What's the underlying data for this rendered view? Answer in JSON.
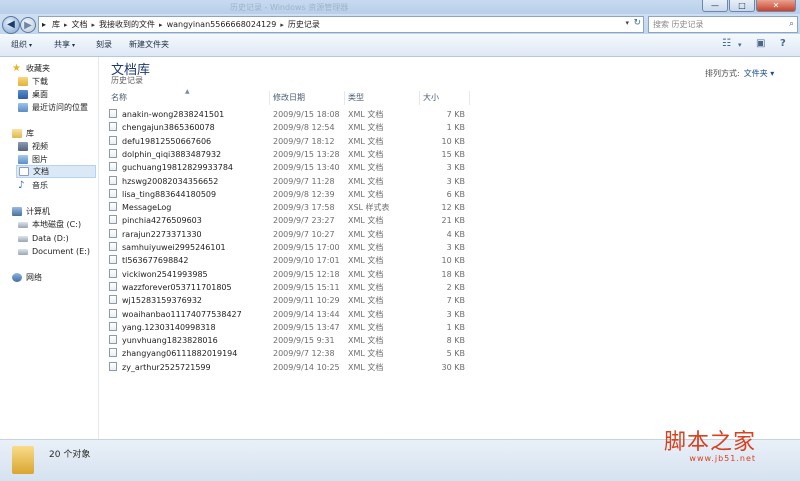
{
  "window": {
    "title_faint": "历史记录 - Windows 资源管理器",
    "minimize_glyph": "—",
    "maximize_glyph": "□",
    "close_glyph": "✕"
  },
  "nav_buttons": {
    "back_glyph": "◀",
    "forward_glyph": "▶"
  },
  "address": {
    "crumbs": [
      "库",
      "文档",
      "我接收到的文件",
      "wangyinan5566668024129",
      "历史记录"
    ],
    "dropdown_glyph": "▾",
    "refresh_glyph": "↻"
  },
  "search": {
    "placeholder": "搜索 历史记录",
    "icon": "search-icon",
    "glyph": "⌕"
  },
  "toolbar": {
    "organize": "组织",
    "share": "共享",
    "burn": "刻录",
    "new_folder": "新建文件夹",
    "caret": "▾",
    "view_glyph": "☷",
    "preview_glyph": "▣",
    "help_glyph": "?"
  },
  "sidebar": {
    "favorites": "收藏夹",
    "downloads": "下载",
    "desktop": "桌面",
    "recent": "最近访问的位置",
    "libraries": "库",
    "videos": "视频",
    "pictures": "图片",
    "documents": "文档",
    "music": "音乐",
    "computer": "计算机",
    "drive_c": "本地磁盘 (C:)",
    "drive_d": "Data (D:)",
    "drive_e": "Document (E:)",
    "network": "网络",
    "star_glyph": "★",
    "music_glyph": "♪"
  },
  "library": {
    "title": "文档库",
    "subtitle": "历史记录",
    "arrange_label": "排列方式:",
    "arrange_value": "文件夹 ▾"
  },
  "columns": {
    "name": "名称",
    "modified": "修改日期",
    "type": "类型",
    "size": "大小",
    "sort_glyph": "▲"
  },
  "files": [
    {
      "name": "anakin-wong2838241501",
      "date": "2009/9/15 18:08",
      "type": "XML 文档",
      "size": "7 KB"
    },
    {
      "name": "chengajun3865360078",
      "date": "2009/9/8 12:54",
      "type": "XML 文档",
      "size": "1 KB"
    },
    {
      "name": "defu19812550667606",
      "date": "2009/9/7 18:12",
      "type": "XML 文档",
      "size": "10 KB"
    },
    {
      "name": "dolphin_qiqi3883487932",
      "date": "2009/9/15 13:28",
      "type": "XML 文档",
      "size": "15 KB"
    },
    {
      "name": "guchuang19812829933784",
      "date": "2009/9/15 13:40",
      "type": "XML 文档",
      "size": "3 KB"
    },
    {
      "name": "hzswg20082034356652",
      "date": "2009/9/7 11:28",
      "type": "XML 文档",
      "size": "3 KB"
    },
    {
      "name": "lisa_ting883644180509",
      "date": "2009/9/8 12:39",
      "type": "XML 文档",
      "size": "6 KB"
    },
    {
      "name": "MessageLog",
      "date": "2009/9/3 17:58",
      "type": "XSL 样式表",
      "size": "12 KB"
    },
    {
      "name": "pinchia4276509603",
      "date": "2009/9/7 23:27",
      "type": "XML 文档",
      "size": "21 KB"
    },
    {
      "name": "rarajun2273371330",
      "date": "2009/9/7 10:27",
      "type": "XML 文档",
      "size": "4 KB"
    },
    {
      "name": "samhuiyuwei2995246101",
      "date": "2009/9/15 17:00",
      "type": "XML 文档",
      "size": "3 KB"
    },
    {
      "name": "tl563677698842",
      "date": "2009/9/10 17:01",
      "type": "XML 文档",
      "size": "10 KB"
    },
    {
      "name": "vickiwon2541993985",
      "date": "2009/9/15 12:18",
      "type": "XML 文档",
      "size": "18 KB"
    },
    {
      "name": "wazzforever053711701805",
      "date": "2009/9/15 15:11",
      "type": "XML 文档",
      "size": "2 KB"
    },
    {
      "name": "wj15283159376932",
      "date": "2009/9/11 10:29",
      "type": "XML 文档",
      "size": "7 KB"
    },
    {
      "name": "woaihanbao11174077538427",
      "date": "2009/9/14 13:44",
      "type": "XML 文档",
      "size": "3 KB"
    },
    {
      "name": "yang.12303140998318",
      "date": "2009/9/15 13:47",
      "type": "XML 文档",
      "size": "1 KB"
    },
    {
      "name": "yunvhuang1823828016",
      "date": "2009/9/15 9:31",
      "type": "XML 文档",
      "size": "8 KB"
    },
    {
      "name": "zhangyang06111882019194",
      "date": "2009/9/7 12:38",
      "type": "XML 文档",
      "size": "5 KB"
    },
    {
      "name": "zy_arthur2525721599",
      "date": "2009/9/14 10:25",
      "type": "XML 文档",
      "size": "30 KB"
    }
  ],
  "status": {
    "count": "20 个对象"
  },
  "watermark": {
    "text": "脚本之家",
    "url": "www.jb51.net"
  }
}
